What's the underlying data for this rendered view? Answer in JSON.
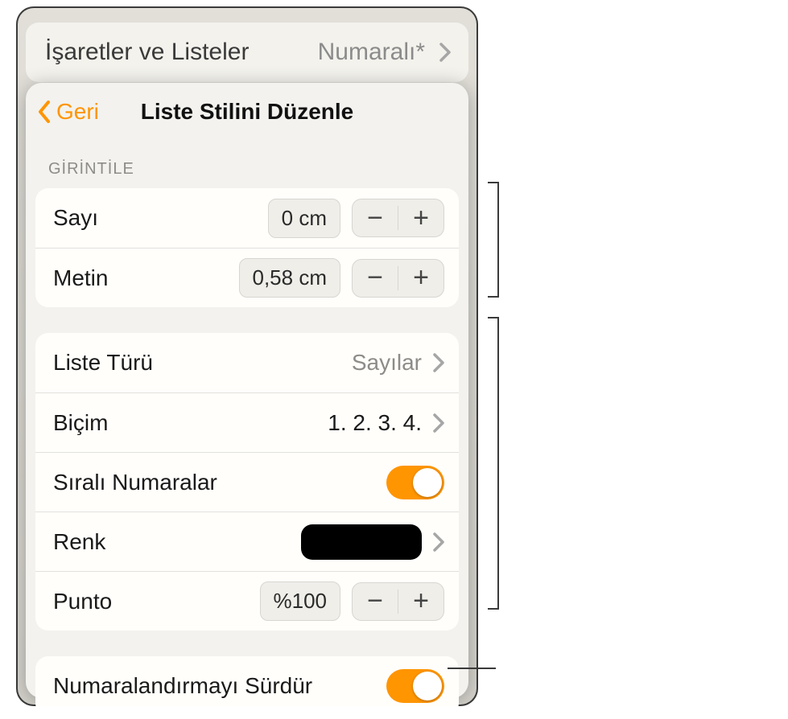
{
  "backdrop": {
    "title": "İşaretler ve Listeler",
    "value": "Numaralı*"
  },
  "header": {
    "back": "Geri",
    "title": "Liste Stilini Düzenle"
  },
  "section_indent_label": "GİRİNTİLE",
  "indent": {
    "number_label": "Sayı",
    "number_value": "0 cm",
    "text_label": "Metin",
    "text_value": "0,58 cm"
  },
  "list": {
    "type_label": "Liste Türü",
    "type_value": "Sayılar",
    "format_label": "Biçim",
    "format_value": "1. 2. 3. 4.",
    "tiered_label": "Sıralı Numaralar",
    "color_label": "Renk",
    "size_label": "Punto",
    "size_value": "%100"
  },
  "continue": {
    "label": "Numaralandırmayı Sürdür"
  },
  "glyphs": {
    "minus": "−",
    "plus": "+"
  },
  "toggles": {
    "tiered_on": true,
    "continue_on": true
  },
  "colors": {
    "accent": "#ff9500",
    "swatch": "#000000"
  }
}
